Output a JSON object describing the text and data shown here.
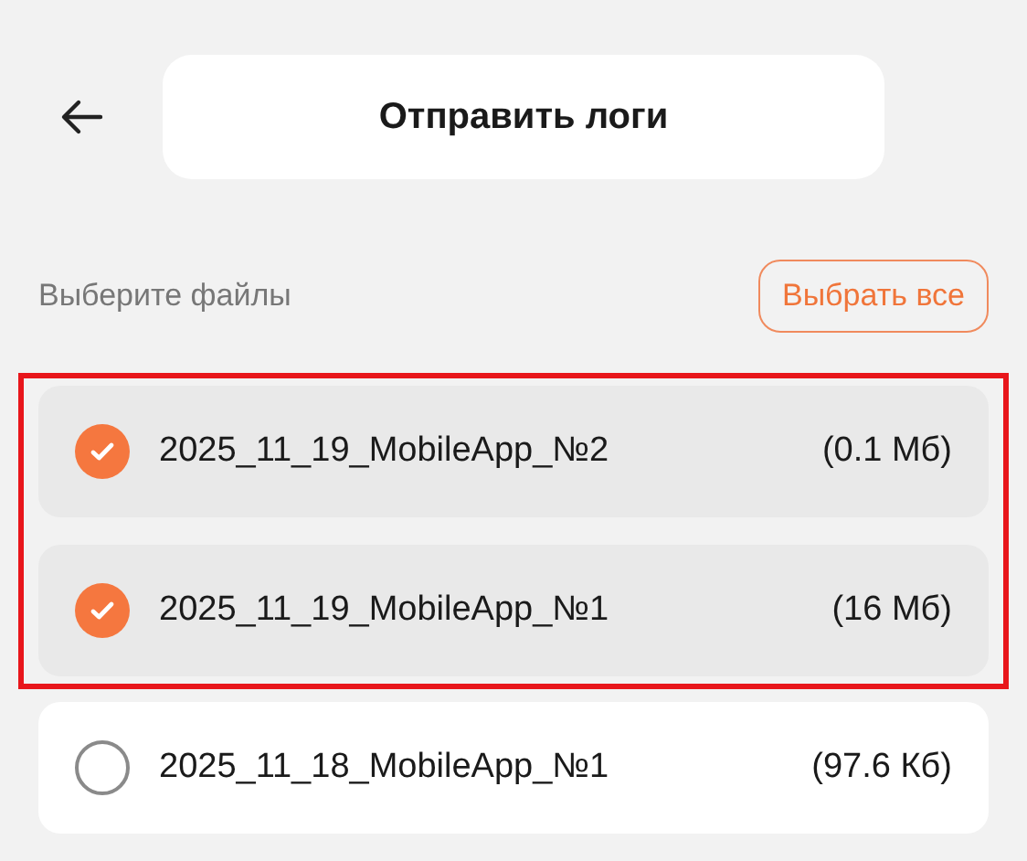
{
  "header": {
    "title": "Отправить логи"
  },
  "section": {
    "label": "Выберите файлы",
    "select_all": "Выбрать все"
  },
  "files": [
    {
      "name": "2025_11_19_MobileApp_№2",
      "size": "(0.1 Мб)",
      "checked": true,
      "highlighted": true
    },
    {
      "name": "2025_11_19_MobileApp_№1",
      "size": "(16 Мб)",
      "checked": true,
      "highlighted": true
    },
    {
      "name": "2025_11_18_MobileApp_№1",
      "size": "(97.6 Кб)",
      "checked": false,
      "highlighted": false
    }
  ]
}
